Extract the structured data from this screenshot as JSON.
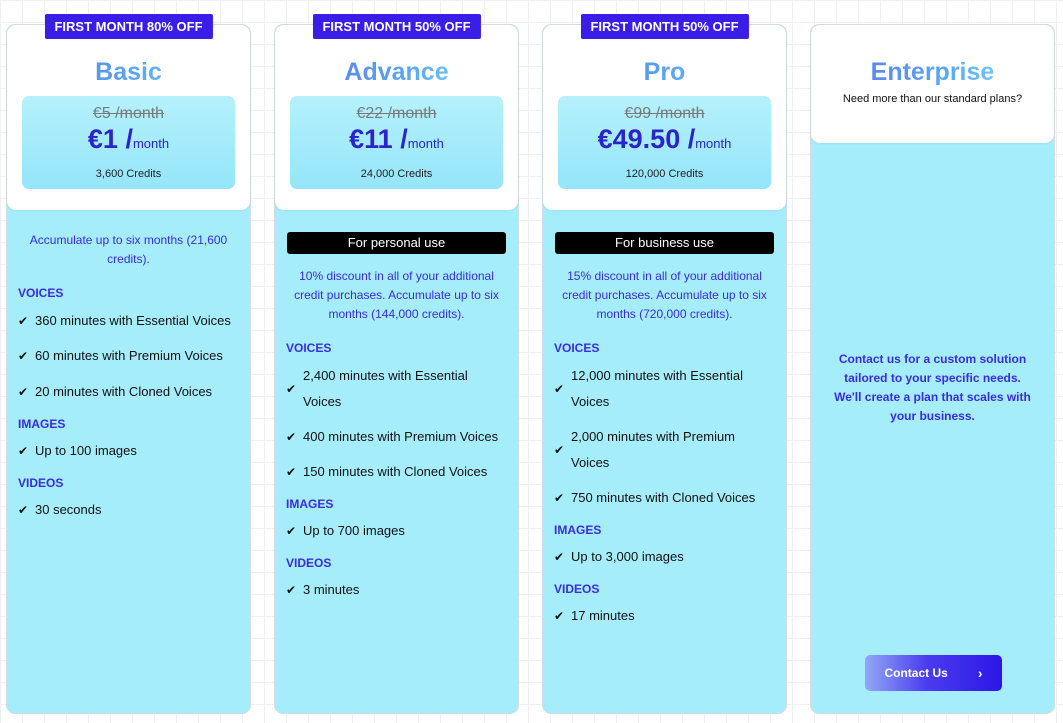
{
  "plans": [
    {
      "promo": "FIRST MONTH 80% OFF",
      "name": "Basic",
      "old_price": "€5 /month",
      "new_price": "€1 /",
      "period": "month",
      "credits": "3,600 Credits",
      "use": null,
      "description": "Accumulate up to six months (21,600 credits).",
      "sections": [
        {
          "title": "VOICES",
          "items": [
            "360 minutes with Essential Voices",
            "60 minutes with Premium Voices",
            "20 minutes with Cloned Voices"
          ]
        },
        {
          "title": "IMAGES",
          "items": [
            "Up to 100 images"
          ]
        },
        {
          "title": "VIDEOS",
          "items": [
            "30 seconds"
          ]
        }
      ]
    },
    {
      "promo": "FIRST MONTH 50% OFF",
      "name": "Advance",
      "old_price": "€22 /month",
      "new_price": "€11 /",
      "period": "month",
      "credits": "24,000 Credits",
      "use": "For personal use",
      "description": "10% discount in all of your additional credit purchases. Accumulate up to six months (144,000 credits).",
      "sections": [
        {
          "title": "VOICES",
          "items": [
            "2,400 minutes with Essential Voices",
            "400 minutes with Premium Voices",
            "150 minutes with Cloned Voices"
          ]
        },
        {
          "title": "IMAGES",
          "items": [
            "Up to 700 images"
          ]
        },
        {
          "title": "VIDEOS",
          "items": [
            "3 minutes"
          ]
        }
      ]
    },
    {
      "promo": "FIRST MONTH 50% OFF",
      "name": "Pro",
      "old_price": "€99 /month",
      "new_price": "€49.50 /",
      "period": "month",
      "credits": "120,000 Credits",
      "use": "For business use",
      "description": "15% discount in all of your additional credit purchases. Accumulate up to six months (720,000 credits).",
      "sections": [
        {
          "title": "VOICES",
          "items": [
            "12,000 minutes with Essential Voices",
            "2,000 minutes with Premium Voices",
            "750 minutes with Cloned Voices"
          ]
        },
        {
          "title": "IMAGES",
          "items": [
            "Up to 3,000 images"
          ]
        },
        {
          "title": "VIDEOS",
          "items": [
            "17 minutes"
          ]
        }
      ]
    }
  ],
  "enterprise": {
    "name": "Enterprise",
    "subtitle": "Need more than our standard plans?",
    "contact_text": "Contact us for a custom solution tailored to your specific needs. We'll create a plan that scales with your business.",
    "button_label": "Contact Us",
    "button_icon": "chevron-right-icon"
  },
  "icons": {
    "check": "✔",
    "chevron": "›"
  },
  "colors": {
    "accent": "#3a1ee8",
    "card_bg": "#a6edfb",
    "text_accent": "#3a2ce0"
  }
}
